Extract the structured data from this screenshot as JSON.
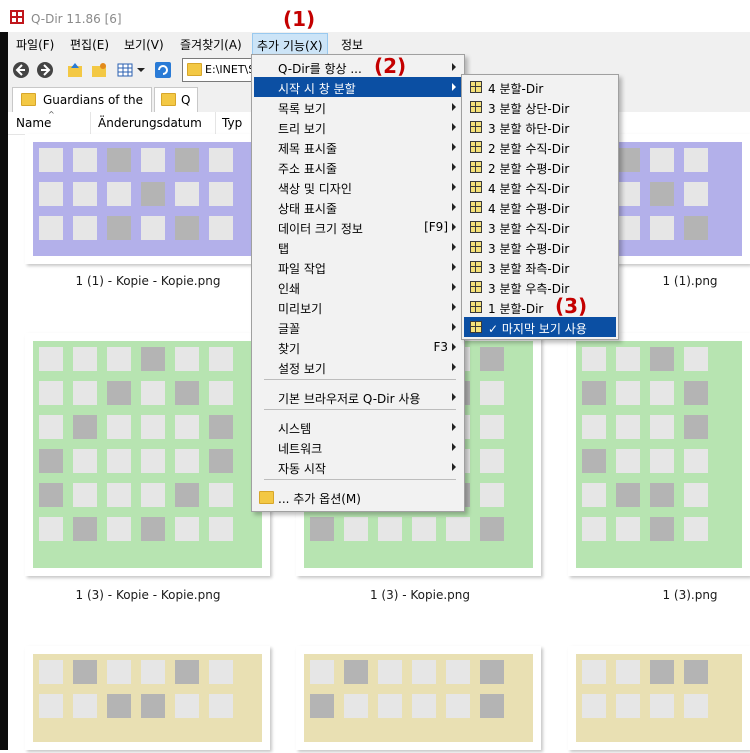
{
  "app": {
    "title": "Q-Dir 11.86 [6]"
  },
  "menubar": {
    "items": [
      "파일(F)",
      "편집(E)",
      "보기(V)",
      "즐겨찾기(A)",
      "추가 기능(X)",
      "정보"
    ]
  },
  "toolbar": {
    "address": "E:\\INET\\Sc"
  },
  "tabs": [
    "Guardians of the ...",
    "Q"
  ],
  "columns": [
    "Name",
    "Änderungsdatum",
    "Typ"
  ],
  "thumbnails": {
    "captions": [
      "1 (1) - Kopie - Kopie.png",
      "1 (1).png",
      "1 (3) - Kopie - Kopie.png",
      "1 (3) - Kopie.png",
      "1 (3).png"
    ],
    "colors": {
      "purple": "#b3b0ea",
      "green": "#b7e4b1",
      "yellow": "#e9e0b3",
      "cell": "#e6e6e6",
      "dark": "#b4b4b4"
    }
  },
  "extras_menu": {
    "items": [
      {
        "label": "Q-Dir를 항상 ...",
        "shortcut": "",
        "submenu": true
      },
      {
        "label": "시작 시 창 분할",
        "shortcut": "",
        "submenu": true,
        "selected": true
      },
      {
        "label": "목록 보기",
        "shortcut": "",
        "submenu": true
      },
      {
        "label": "트리 보기",
        "shortcut": "",
        "submenu": true
      },
      {
        "label": "제목 표시줄",
        "shortcut": "",
        "submenu": true
      },
      {
        "label": "주소 표시줄",
        "shortcut": "",
        "submenu": true
      },
      {
        "label": "색상 및 디자인",
        "shortcut": "",
        "submenu": true
      },
      {
        "label": "상태 표시줄",
        "shortcut": "",
        "submenu": true
      },
      {
        "label": "데이터 크기 정보",
        "shortcut": "[F9]",
        "submenu": true
      },
      {
        "label": "탭",
        "shortcut": "",
        "submenu": true
      },
      {
        "label": "파일 작업",
        "shortcut": "",
        "submenu": true
      },
      {
        "label": "인쇄",
        "shortcut": "",
        "submenu": true
      },
      {
        "label": "미리보기",
        "shortcut": "",
        "submenu": true
      },
      {
        "label": "글꼴",
        "shortcut": "",
        "submenu": true
      },
      {
        "label": "찾기",
        "shortcut": "F3",
        "submenu": true
      },
      {
        "label": "설정 보기",
        "shortcut": "",
        "submenu": true
      },
      {
        "label": "기본 브라우저로 Q-Dir 사용",
        "shortcut": "",
        "submenu": true
      },
      {
        "label": "시스템",
        "shortcut": "",
        "submenu": true
      },
      {
        "label": "네트워크",
        "shortcut": "",
        "submenu": true
      },
      {
        "label": "자동 시작",
        "shortcut": "",
        "submenu": true
      },
      {
        "label": "... 추가 옵션(M)",
        "shortcut": "",
        "submenu": false
      }
    ]
  },
  "split_submenu": {
    "items": [
      "4 분할-Dir",
      "3 분할 상단-Dir",
      "3 분할 하단-Dir",
      "2 분할 수직-Dir",
      "2 분할 수평-Dir",
      "4 분할 수직-Dir",
      "4 분할 수평-Dir",
      "3 분할 수직-Dir",
      "3 분할 수평-Dir",
      "3 분할 좌측-Dir",
      "3 분할 우측-Dir",
      "1 분할-Dir",
      "✓ 마지막 보기 사용"
    ],
    "selected_index": 12
  },
  "callouts": [
    "(1)",
    "(2)",
    "(3)"
  ]
}
